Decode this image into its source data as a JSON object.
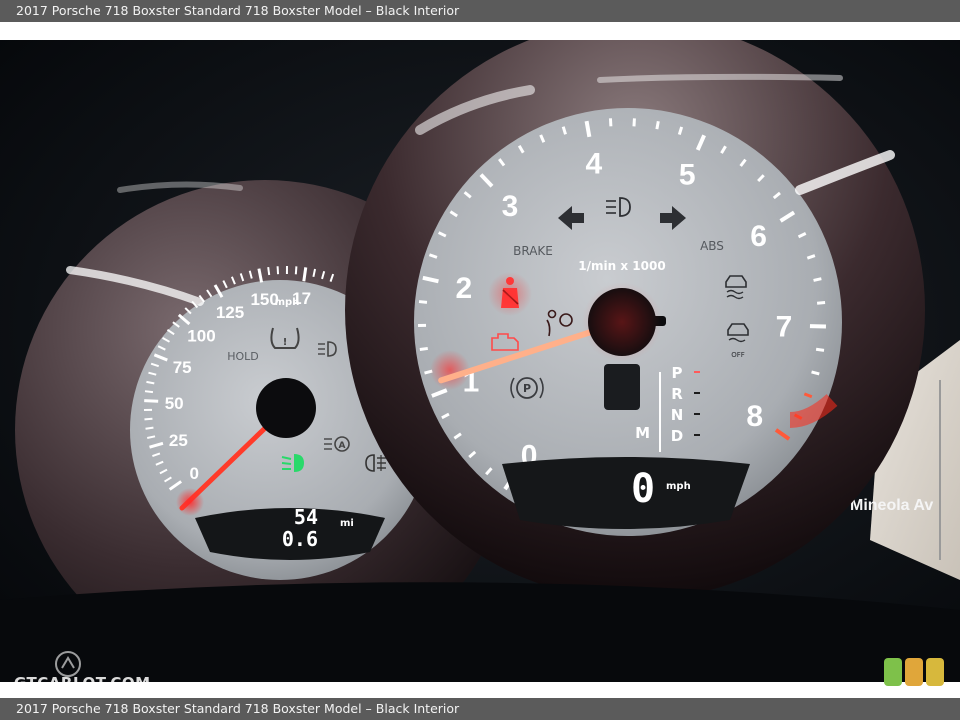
{
  "header": {
    "title": "2017 Porsche 718 Boxster Standard 718 Boxster Model – Black Interior"
  },
  "footer": {
    "caption": "2017 Porsche 718 Boxster Standard 718 Boxster Model – Black Interior"
  },
  "watermark": {
    "text": "GTCARLOT.COM"
  },
  "tachometer": {
    "numbers": [
      "0",
      "1",
      "2",
      "3",
      "4",
      "5",
      "6",
      "7",
      "8"
    ],
    "unit_label": "1/min x 1000",
    "brake_label": "BRAKE",
    "abs_label": "ABS",
    "off_label": "OFF",
    "gear_letters": [
      "P",
      "R",
      "N",
      "D"
    ],
    "manual_label": "M",
    "speed_value": "0",
    "speed_unit": "mph",
    "needle_value": 1.1
  },
  "speedometer": {
    "numbers": [
      "0",
      "25",
      "50",
      "75",
      "100",
      "125",
      "150",
      "17"
    ],
    "unit_label": "mph",
    "hold_label": "HOLD",
    "odometer": "54",
    "odometer_unit": "mi",
    "trip": "0.6"
  },
  "map_fragment": {
    "text": "Mineola Av"
  },
  "colors": {
    "needle": "#ff5a3c",
    "warning_red": "#ff3b3b",
    "indicator_green": "#29d96a",
    "dial_face": "#b9bcc0"
  }
}
